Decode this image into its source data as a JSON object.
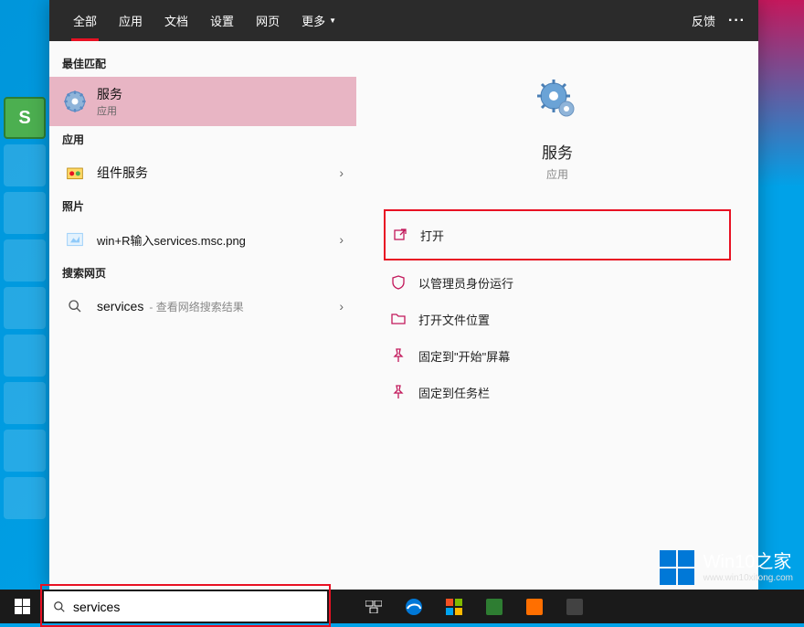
{
  "tabs": {
    "items": [
      "全部",
      "应用",
      "文档",
      "设置",
      "网页",
      "更多"
    ],
    "feedback": "反馈"
  },
  "sections": {
    "best_match": "最佳匹配",
    "apps": "应用",
    "photos": "照片",
    "search_web": "搜索网页"
  },
  "results": {
    "best": {
      "title": "服务",
      "sub": "应用"
    },
    "app_item": {
      "title": "组件服务"
    },
    "photo_item": {
      "title": "win+R输入services.msc.png"
    },
    "web_item": {
      "query": "services",
      "suffix": "- 查看网络搜索结果"
    }
  },
  "hero": {
    "title": "服务",
    "sub": "应用"
  },
  "actions": {
    "open": "打开",
    "run_admin": "以管理员身份运行",
    "open_location": "打开文件位置",
    "pin_start": "固定到\"开始\"屏幕",
    "pin_taskbar": "固定到任务栏"
  },
  "search": {
    "value": "services"
  },
  "watermark": {
    "title": "Win10之家",
    "url": "www.win10xitong.com"
  }
}
